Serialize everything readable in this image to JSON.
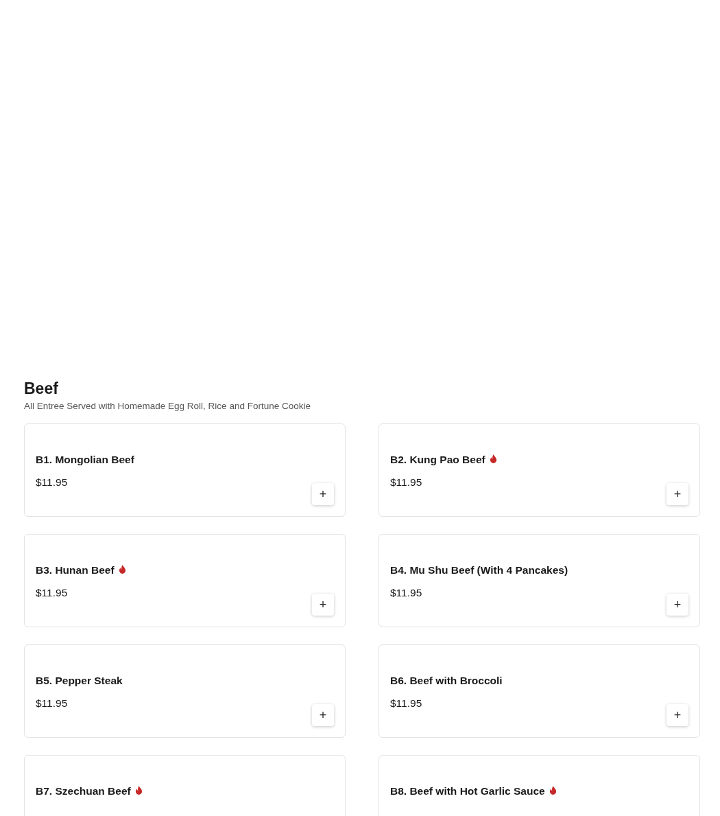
{
  "section": {
    "title": "Beef",
    "subtitle": "All Entree Served with Homemade Egg Roll, Rice and Fortune Cookie"
  },
  "items": [
    {
      "name": "B1. Mongolian Beef",
      "spicy": false,
      "price": "$11.95",
      "add": "+"
    },
    {
      "name": "B2. Kung Pao Beef",
      "spicy": true,
      "price": "$11.95",
      "add": "+"
    },
    {
      "name": "B3. Hunan Beef",
      "spicy": true,
      "price": "$11.95",
      "add": "+"
    },
    {
      "name": "B4. Mu Shu Beef (With 4 Pancakes)",
      "spicy": false,
      "price": "$11.95",
      "add": "+"
    },
    {
      "name": "B5. Pepper Steak",
      "spicy": false,
      "price": "$11.95",
      "add": "+"
    },
    {
      "name": "B6. Beef with Broccoli",
      "spicy": false,
      "price": "$11.95",
      "add": "+"
    },
    {
      "name": "B7. Szechuan Beef",
      "spicy": true
    },
    {
      "name": "B8. Beef with Hot Garlic Sauce",
      "spicy": true
    }
  ]
}
